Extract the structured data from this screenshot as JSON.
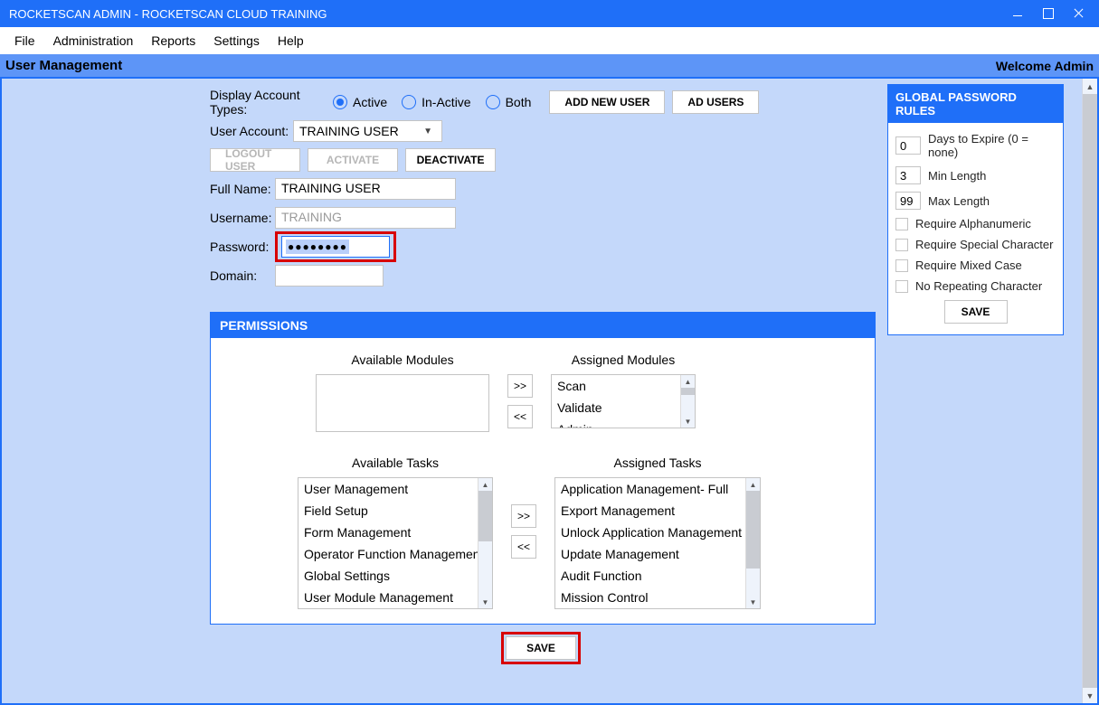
{
  "window": {
    "title": "ROCKETSCAN ADMIN - ROCKETSCAN CLOUD TRAINING"
  },
  "menu": {
    "file": "File",
    "administration": "Administration",
    "reports": "Reports",
    "settings": "Settings",
    "help": "Help"
  },
  "subheader": {
    "title": "User Management",
    "welcome": "Welcome Admin"
  },
  "form": {
    "display_label": "Display Account Types:",
    "radio_active": "Active",
    "radio_inactive": "In-Active",
    "radio_both": "Both",
    "add_new_user": "ADD NEW USER",
    "ad_users": "AD USERS",
    "user_account_label": "User Account:",
    "user_account_value": "TRAINING USER",
    "logout_user": "LOGOUT USER",
    "activate": "ACTIVATE",
    "deactivate": "DEACTIVATE",
    "fullname_label": "Full Name:",
    "fullname_value": "TRAINING USER",
    "username_label": "Username:",
    "username_value": "TRAINING",
    "password_label": "Password:",
    "password_mask": "●●●●●●●●",
    "domain_label": "Domain:",
    "domain_value": ""
  },
  "rules": {
    "title": "GLOBAL PASSWORD RULES",
    "expire_value": "0",
    "expire_label": "Days to Expire (0 = none)",
    "min_value": "3",
    "min_label": "Min Length",
    "max_value": "99",
    "max_label": "Max Length",
    "alnum": "Require Alphanumeric",
    "special": "Require Special Character",
    "mixed": "Require Mixed Case",
    "norepeat": "No Repeating Character",
    "save": "SAVE"
  },
  "perm": {
    "title": "PERMISSIONS",
    "avail_modules": "Available Modules",
    "assigned_modules": "Assigned Modules",
    "avail_tasks": "Available Tasks",
    "assigned_tasks": "Assigned Tasks",
    "assigned_modules_items": {
      "0": "Scan",
      "1": "Validate",
      "2": "Admin"
    },
    "avail_tasks_items": {
      "0": "User Management",
      "1": "Field Setup",
      "2": "Form Management",
      "3": "Operator Function Management",
      "4": "Global Settings",
      "5": "User Module Management"
    },
    "assigned_tasks_items": {
      "0": "Application Management- Full",
      "1": "Export Management",
      "2": "Unlock Application Management",
      "3": "Update Management",
      "4": "Audit Function",
      "5": "Mission Control"
    },
    "to_right": ">>",
    "to_left": "<<",
    "save": "SAVE"
  }
}
